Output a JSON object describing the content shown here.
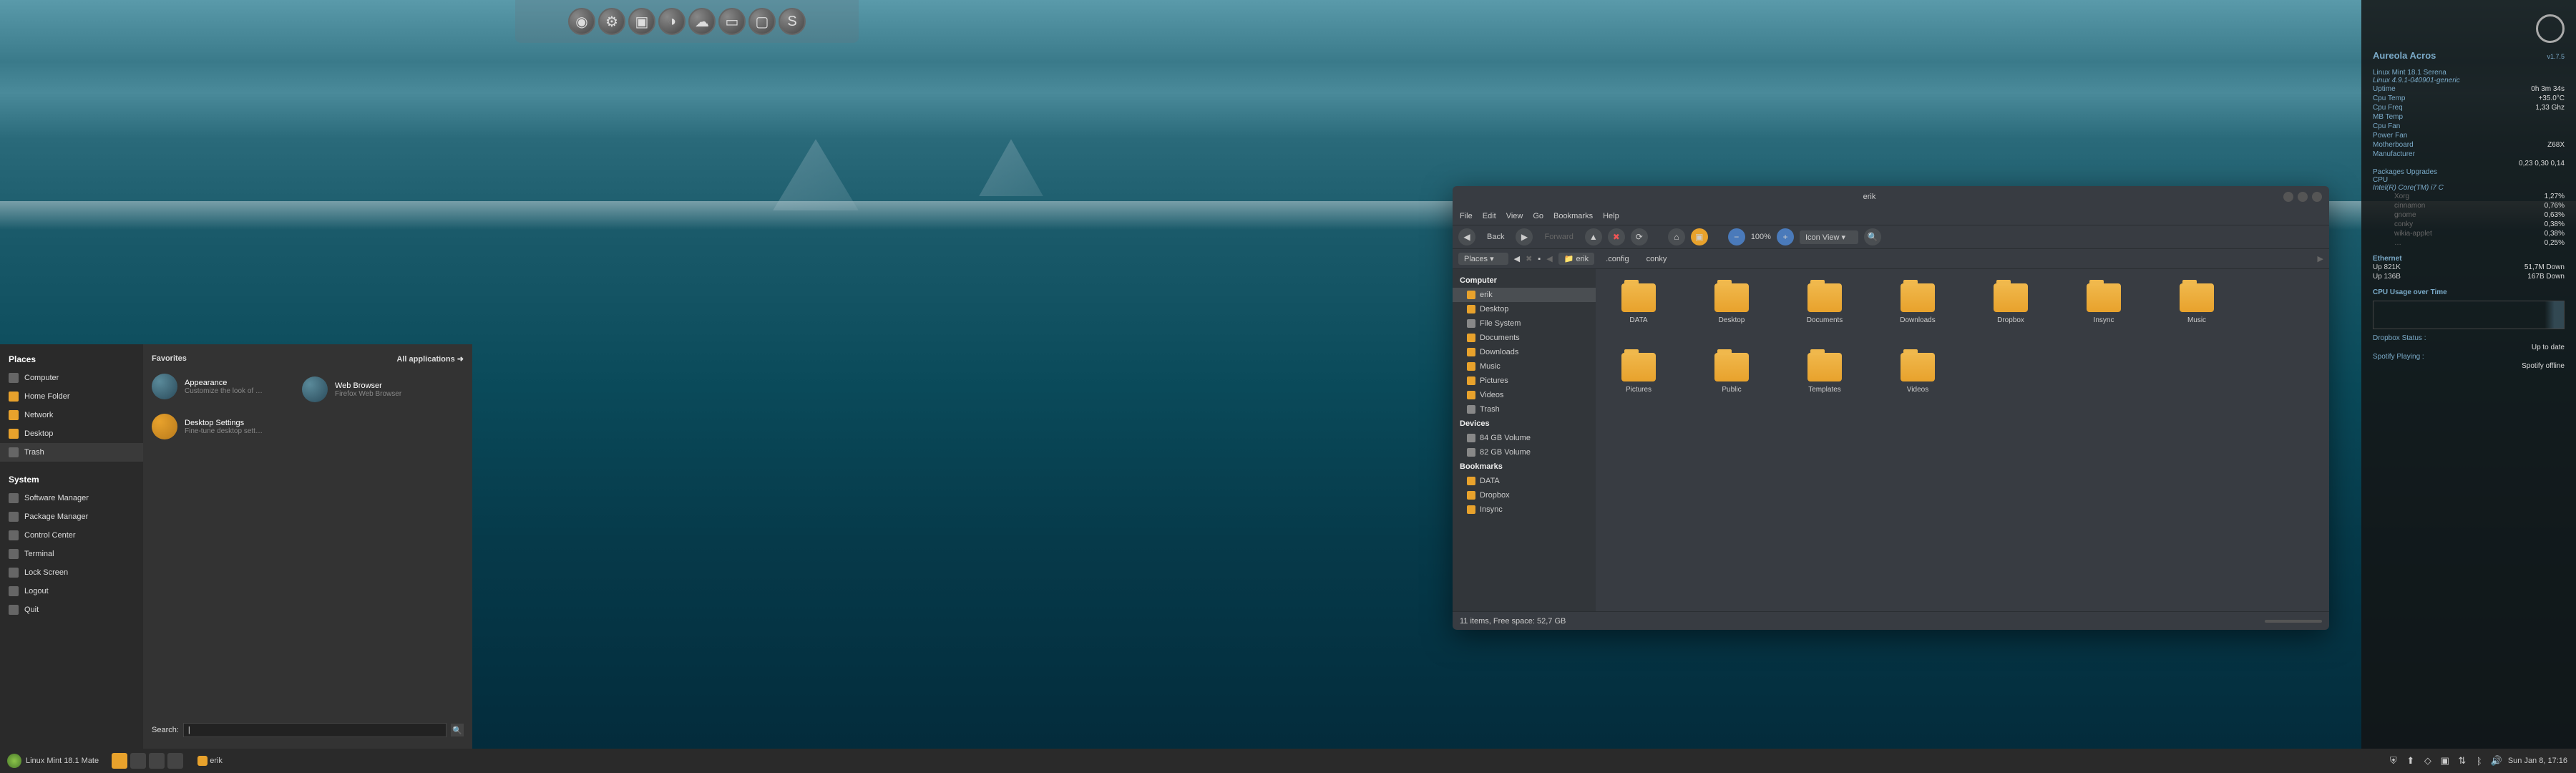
{
  "launcher_icons": [
    "firefox",
    "steam",
    "terminal",
    "chrome",
    "tweet",
    "briefcase",
    "display",
    "skype"
  ],
  "start_menu": {
    "places_title": "Places",
    "places": [
      "Computer",
      "Home Folder",
      "Network",
      "Desktop",
      "Trash"
    ],
    "system_title": "System",
    "system": [
      "Software Manager",
      "Package Manager",
      "Control Center",
      "Terminal",
      "Lock Screen",
      "Logout",
      "Quit"
    ],
    "favorites_title": "Favorites",
    "all_apps": "All applications",
    "favorites": [
      {
        "title": "Appearance",
        "sub": "Customize the look of …"
      },
      {
        "title": "Web Browser",
        "sub": "Firefox Web Browser"
      },
      {
        "title": "Desktop Settings",
        "sub": "Fine-tune desktop sett…"
      }
    ],
    "search_label": "Search:",
    "search_value": "|"
  },
  "taskbar": {
    "distro": "Linux Mint 18.1 Mate",
    "task": "erik",
    "clock": "Sun Jan  8, 17:16"
  },
  "file_manager": {
    "title": "erik",
    "menus": [
      "File",
      "Edit",
      "View",
      "Go",
      "Bookmarks",
      "Help"
    ],
    "back": "Back",
    "forward": "Forward",
    "zoom": "100%",
    "view_mode": "Icon View",
    "path_label": "Places",
    "crumbs": [
      "erik",
      ".config",
      "conky"
    ],
    "sidebar": {
      "computer": "Computer",
      "computer_items": [
        "erik",
        "Desktop",
        "File System",
        "Documents",
        "Downloads",
        "Music",
        "Pictures",
        "Videos",
        "Trash"
      ],
      "devices": "Devices",
      "device_items": [
        "84 GB Volume",
        "82 GB Volume"
      ],
      "bookmarks": "Bookmarks",
      "bookmark_items": [
        "DATA",
        "Dropbox",
        "Insync"
      ]
    },
    "folders": [
      "DATA",
      "Desktop",
      "Documents",
      "Downloads",
      "Dropbox",
      "Insync",
      "Music",
      "Pictures",
      "Public",
      "Templates",
      "Videos"
    ],
    "status": "11 items, Free space: 52,7 GB"
  },
  "conky": {
    "title": "Aureola Acros",
    "version": "v1.7.5",
    "distro": "Linux Mint 18.1 Serena",
    "kernel": "Linux 4.9.1-040901-generic",
    "rows": [
      [
        "Uptime",
        "0h 3m 34s"
      ],
      [
        "Cpu Temp",
        "+35.0°C"
      ],
      [
        "Cpu Freq",
        "1,33 Ghz"
      ],
      [
        "MB Temp",
        ""
      ],
      [
        "Cpu Fan",
        ""
      ],
      [
        "Power Fan",
        ""
      ],
      [
        "Motherboard",
        "Z68X"
      ],
      [
        "Manufacturer",
        ""
      ]
    ],
    "load": "0,23 0,30 0,14",
    "pkg": "Packages Upgrades",
    "cpu_label": "CPU",
    "cpu_model": "Intel(R) Core(TM) i7 C",
    "cores": [
      [
        "Xorg",
        "1,27%"
      ],
      [
        "cinnamon",
        "0,76%"
      ],
      [
        "gnome",
        "0,63%"
      ],
      [
        "conky",
        "0,38%"
      ],
      [
        "wikia-applet",
        "0,38%"
      ],
      [
        "…",
        "0,25%"
      ]
    ],
    "eth": "Ethernet",
    "up": "Up 821K",
    "up_val": "51,7M Down",
    "up2": "Up 136B",
    "up2_val": "167B Down",
    "cpu_time": "CPU Usage over Time",
    "dropbox_label": "Dropbox Status :",
    "dropbox_val": "Up to date",
    "spotify_label": "Spotify Playing :",
    "spotify_val": "Spotify offline"
  }
}
